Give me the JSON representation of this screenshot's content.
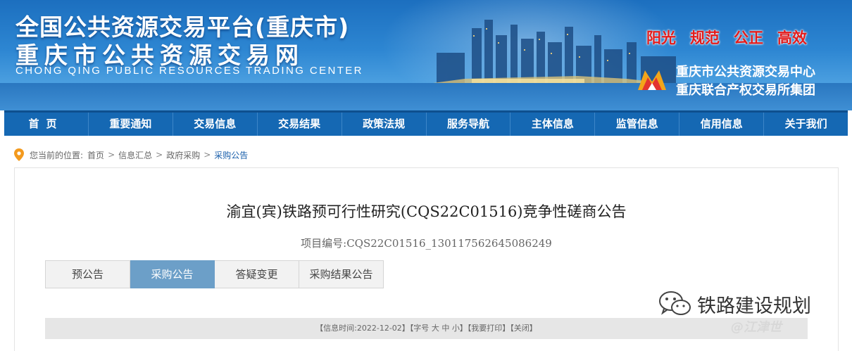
{
  "banner": {
    "title_line1": "全国公共资源交易平台(重庆市)",
    "title_line2": "重庆市公共资源交易网",
    "title_en": "CHONG QING PUBLIC RESOURCES TRADING CENTER",
    "slogans": [
      "阳光",
      "规范",
      "公正",
      "高效"
    ],
    "org_name1": "重庆市公共资源交易中心",
    "org_name2": "重庆联合产权交易所集团",
    "colors": {
      "banner": "#2d86d2",
      "slogan": "#e31b1b"
    }
  },
  "nav": {
    "items": [
      "首页",
      "重要通知",
      "交易信息",
      "交易结果",
      "政策法规",
      "服务导航",
      "主体信息",
      "监管信息",
      "信用信息",
      "关于我们"
    ],
    "color": "#1568b3"
  },
  "breadcrumb": {
    "prefix": "您当前的位置:",
    "items": [
      "首页",
      "信息汇总",
      "政府采购",
      "采购公告"
    ],
    "separator": ">"
  },
  "content": {
    "title": "渝宜(宾)铁路预可行性研究(CQS22C01516)竞争性磋商公告",
    "project_no": "项目编号:CQS22C01516_130117562645086249",
    "tabs": [
      {
        "label": "预公告",
        "active": false
      },
      {
        "label": "采购公告",
        "active": true
      },
      {
        "label": "答疑变更",
        "active": false
      },
      {
        "label": "采购结果公告",
        "active": false
      }
    ],
    "info": {
      "time": "【信息时间:2022-12-02】",
      "font_label": "【字号",
      "size_large": "大",
      "size_medium": "中",
      "size_small": "小】",
      "print": "【我要打印】",
      "close": "【关闭】"
    }
  },
  "watermark": {
    "text": "铁路建设规划",
    "sub": "@江津世"
  }
}
